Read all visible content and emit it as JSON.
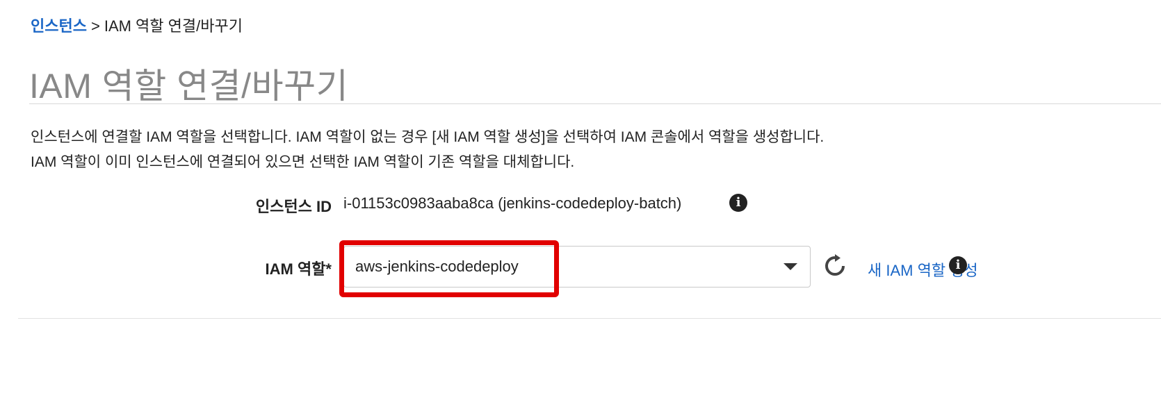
{
  "breadcrumb": {
    "link": "인스턴스",
    "separator": ">",
    "current": "IAM 역할 연결/바꾸기"
  },
  "page_title": "IAM 역할 연결/바꾸기",
  "description": {
    "line1": "인스턴스에 연결할 IAM 역할을 선택합니다. IAM 역할이 없는 경우 [새 IAM 역할 생성]을 선택하여 IAM 콘솔에서 역할을 생성합니다.",
    "line2": "IAM 역할이 이미 인스턴스에 연결되어 있으면 선택한 IAM 역할이 기존 역할을 대체합니다."
  },
  "instance": {
    "label": "인스턴스 ID",
    "value": "i-01153c0983aaba8ca (jenkins-codedeploy-batch)"
  },
  "iam_role": {
    "label": "IAM 역할*",
    "selected": "aws-jenkins-codedeploy",
    "create_link": "새 IAM 역할 생성"
  },
  "icons": {
    "info": "i",
    "refresh": "refresh-icon",
    "caret": "chevron-down-icon"
  },
  "colors": {
    "link": "#1a66c6",
    "highlight": "#e10000",
    "title": "#888888"
  }
}
